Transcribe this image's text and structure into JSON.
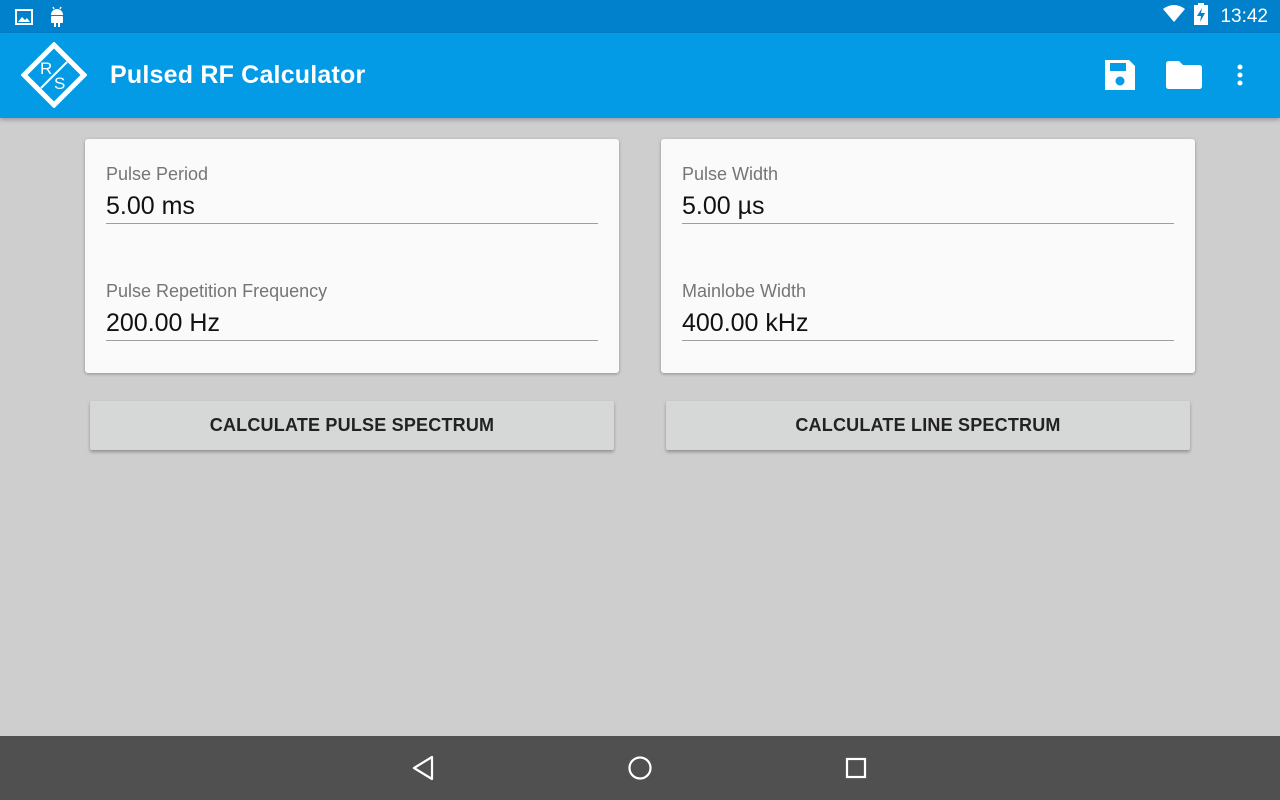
{
  "status_bar": {
    "time": "13:42",
    "left_icons": [
      "image-icon",
      "android-icon"
    ],
    "right_icons": [
      "wifi-icon",
      "battery-charging-icon"
    ]
  },
  "app_bar": {
    "title": "Pulsed RF Calculator",
    "logo": "rohde-schwarz-logo",
    "actions": [
      "save-icon",
      "folder-icon",
      "more-vert-icon"
    ]
  },
  "cards": {
    "left": {
      "field1_label": "Pulse Period",
      "field1_value": "5.00 ms",
      "field2_label": "Pulse Repetition Frequency",
      "field2_value": "200.00 Hz"
    },
    "right": {
      "field1_label": "Pulse Width",
      "field1_value": "5.00 µs",
      "field2_label": "Mainlobe Width",
      "field2_value": "400.00 kHz"
    }
  },
  "buttons": {
    "pulse_spectrum": "CALCULATE PULSE SPECTRUM",
    "line_spectrum": "CALCULATE LINE SPECTRUM"
  },
  "nav_bar": {
    "icons": [
      "back-icon",
      "home-icon",
      "recents-icon"
    ]
  },
  "colors": {
    "status_bar": "#0181cc",
    "app_bar": "#039be5",
    "background": "#cecece",
    "card": "#fafafa",
    "button": "#d6d7d7",
    "nav_bar": "#505050"
  }
}
